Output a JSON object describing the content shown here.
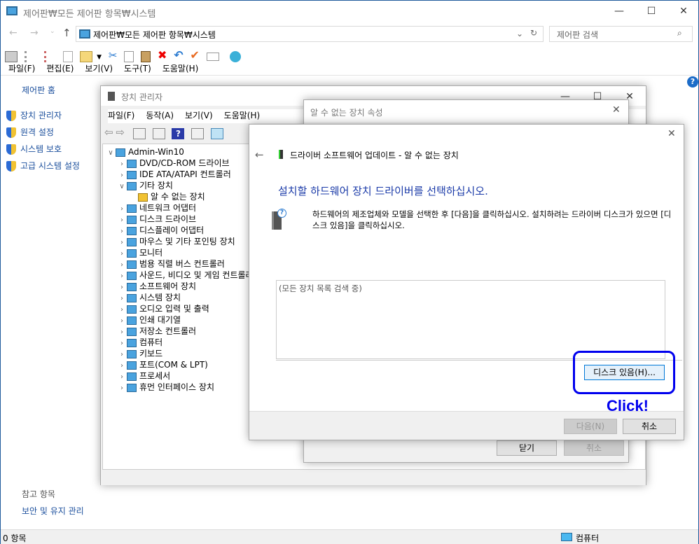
{
  "main": {
    "title": "제어판₩모든 제어판 항목₩시스템",
    "address": "제어판₩모든 제어판 항목₩시스템",
    "search_placeholder": "제어판 검색",
    "menu": [
      "파일(F)",
      "편집(E)",
      "보기(V)",
      "도구(T)",
      "도움말(H)"
    ],
    "home_link": "제어판 홈",
    "side_links": [
      "장치 관리자",
      "원격 설정",
      "시스템 보호",
      "고급 시스템 설정"
    ],
    "see_also": "참고 항목",
    "see_also_links": [
      "보안 및 유지 관리"
    ],
    "status_left": "0 항목",
    "status_right": "컴퓨터"
  },
  "devmgr": {
    "title": "장치 관리자",
    "menu": [
      "파일(F)",
      "동작(A)",
      "보기(V)",
      "도움말(H)"
    ],
    "tree": [
      {
        "label": "Admin-Win10",
        "level": 0,
        "state": "open"
      },
      {
        "label": "DVD/CD-ROM 드라이브",
        "level": 1,
        "state": "closed"
      },
      {
        "label": "IDE ATA/ATAPI 컨트롤러",
        "level": 1,
        "state": "closed"
      },
      {
        "label": "기타 장치",
        "level": 1,
        "state": "open"
      },
      {
        "label": "알 수 없는 장치",
        "level": 2,
        "state": "leaf"
      },
      {
        "label": "네트워크 어댑터",
        "level": 1,
        "state": "closed"
      },
      {
        "label": "디스크 드라이브",
        "level": 1,
        "state": "closed"
      },
      {
        "label": "디스플레이 어댑터",
        "level": 1,
        "state": "closed"
      },
      {
        "label": "마우스 및 기타 포인팅 장치",
        "level": 1,
        "state": "closed"
      },
      {
        "label": "모니터",
        "level": 1,
        "state": "closed"
      },
      {
        "label": "범용 직렬 버스 컨트롤러",
        "level": 1,
        "state": "closed"
      },
      {
        "label": "사운드, 비디오 및 게임 컨트롤러",
        "level": 1,
        "state": "closed"
      },
      {
        "label": "소프트웨어 장치",
        "level": 1,
        "state": "closed"
      },
      {
        "label": "시스템 장치",
        "level": 1,
        "state": "closed"
      },
      {
        "label": "오디오 입력 및 출력",
        "level": 1,
        "state": "closed"
      },
      {
        "label": "인쇄 대기열",
        "level": 1,
        "state": "closed"
      },
      {
        "label": "저장소 컨트롤러",
        "level": 1,
        "state": "closed"
      },
      {
        "label": "컴퓨터",
        "level": 1,
        "state": "closed"
      },
      {
        "label": "키보드",
        "level": 1,
        "state": "closed"
      },
      {
        "label": "포트(COM & LPT)",
        "level": 1,
        "state": "closed"
      },
      {
        "label": "프로세서",
        "level": 1,
        "state": "closed"
      },
      {
        "label": "휴먼 인터페이스 장치",
        "level": 1,
        "state": "closed"
      }
    ]
  },
  "props": {
    "title": "알 수 없는 장치 속성",
    "close_label": "닫기",
    "cancel_label": "취소"
  },
  "wizard": {
    "header": "드라이버 소프트웨어 업데이트 - 알 수 없는 장치",
    "heading": "설치할 하드웨어 장치 드라이버를 선택하십시오.",
    "description": "하드웨어의 제조업체와 모델을 선택한 후 [다음]을 클릭하십시오. 설치하려는 드라이버 디스크가 있으면 [디스크 있음]을 클릭하십시오.",
    "list_status": "(모든 장치 목록 검색 중)",
    "have_disk_label": "디스크 있음(H)...",
    "next_label": "다음(N)",
    "cancel_label": "취소"
  },
  "annotation": {
    "text": "Click!",
    "color": "#0000ee"
  }
}
